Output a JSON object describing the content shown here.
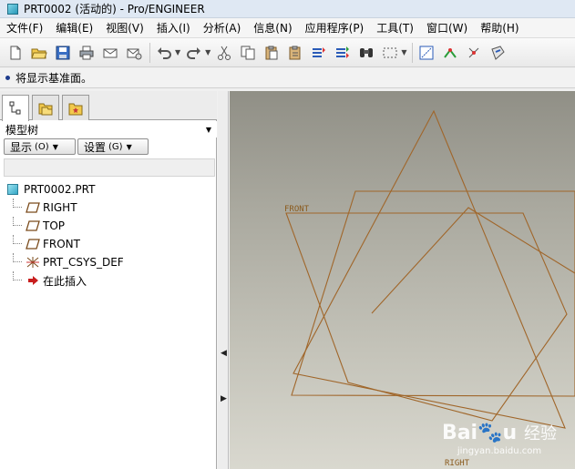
{
  "window": {
    "title": "PRT0002 (活动的) - Pro/ENGINEER"
  },
  "menubar": {
    "items": [
      "文件(F)",
      "编辑(E)",
      "视图(V)",
      "插入(I)",
      "分析(A)",
      "信息(N)",
      "应用程序(P)",
      "工具(T)",
      "窗口(W)",
      "帮助(H)"
    ]
  },
  "toolbar": {
    "icons": [
      "new-file-icon",
      "open-folder-icon",
      "save-icon",
      "print-icon",
      "mail-icon",
      "mail-attach-icon",
      "undo-icon",
      "redo-icon",
      "cut-icon",
      "copy-icon",
      "paste-icon",
      "paste-special-icon",
      "regenerate-icon",
      "regenerate-manager-icon",
      "find-icon",
      "select-box-icon",
      "datum-display-icon",
      "axis-display-icon",
      "point-display-icon",
      "csys-display-icon"
    ]
  },
  "status": {
    "message": "将显示基准面。"
  },
  "model_tree": {
    "tabs": [
      "model-tree-tab",
      "folder-browser-tab",
      "favorites-tab"
    ],
    "header_label": "模型树",
    "show_button": {
      "label": "显示",
      "hotkey": "(O)"
    },
    "settings_button": {
      "label": "设置",
      "hotkey": "(G)"
    },
    "root": "PRT0002.PRT",
    "items": [
      {
        "label": "RIGHT",
        "icon": "datum-plane-icon"
      },
      {
        "label": "TOP",
        "icon": "datum-plane-icon"
      },
      {
        "label": "FRONT",
        "icon": "datum-plane-icon"
      },
      {
        "label": "PRT_CSYS_DEF",
        "icon": "coordinate-system-icon"
      },
      {
        "label": "在此插入",
        "icon": "insert-here-arrow-icon"
      }
    ]
  },
  "viewport": {
    "plane_labels": [
      "FRONT",
      "RIGHT"
    ],
    "watermark": {
      "brand": "Bai",
      "brand_cn": "经验",
      "site": "jingyan.baidu.com"
    }
  },
  "colors": {
    "datum_plane": "#a0662a",
    "viewport_top": "#908f86",
    "viewport_bottom": "#d9d8cf"
  }
}
